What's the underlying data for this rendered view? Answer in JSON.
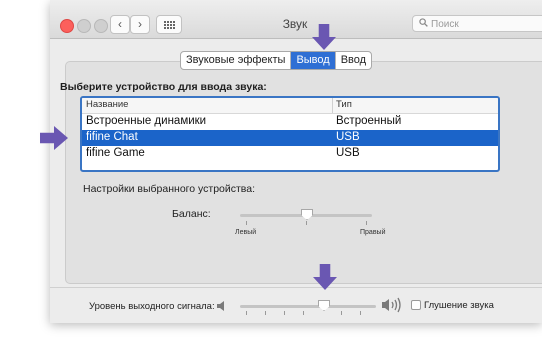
{
  "window": {
    "title": "Звук",
    "search_placeholder": "Поиск",
    "nav_back_icon": "‹",
    "nav_forward_icon": "›"
  },
  "tabs": [
    {
      "label": "Звуковые эффекты",
      "active": false
    },
    {
      "label": "Вывод",
      "active": true
    },
    {
      "label": "Ввод",
      "active": false
    }
  ],
  "device_section": {
    "title": "Выберите устройство для ввода звука:",
    "columns": [
      "Название",
      "Тип"
    ],
    "rows": [
      {
        "name": "Встроенные динамики",
        "type": "Встроенный",
        "selected": false
      },
      {
        "name": "fifine Chat",
        "type": "USB",
        "selected": true
      },
      {
        "name": "fifine Game",
        "type": "USB",
        "selected": false
      }
    ]
  },
  "settings": {
    "label": "Настройки выбранного устройства:",
    "balance_label": "Баланс:",
    "left_label": "Левый",
    "right_label": "Правый",
    "balance_value": 0.5
  },
  "output": {
    "level_label": "Уровень выходного сигнала:",
    "mute_label": "Глушение звука",
    "volume_fraction": 0.6,
    "muted": false
  },
  "colors": {
    "accent": "#2f6fd4",
    "selection": "#1b64c9",
    "annotation_arrow": "#6a57b2",
    "close_button": "#fc605c"
  }
}
